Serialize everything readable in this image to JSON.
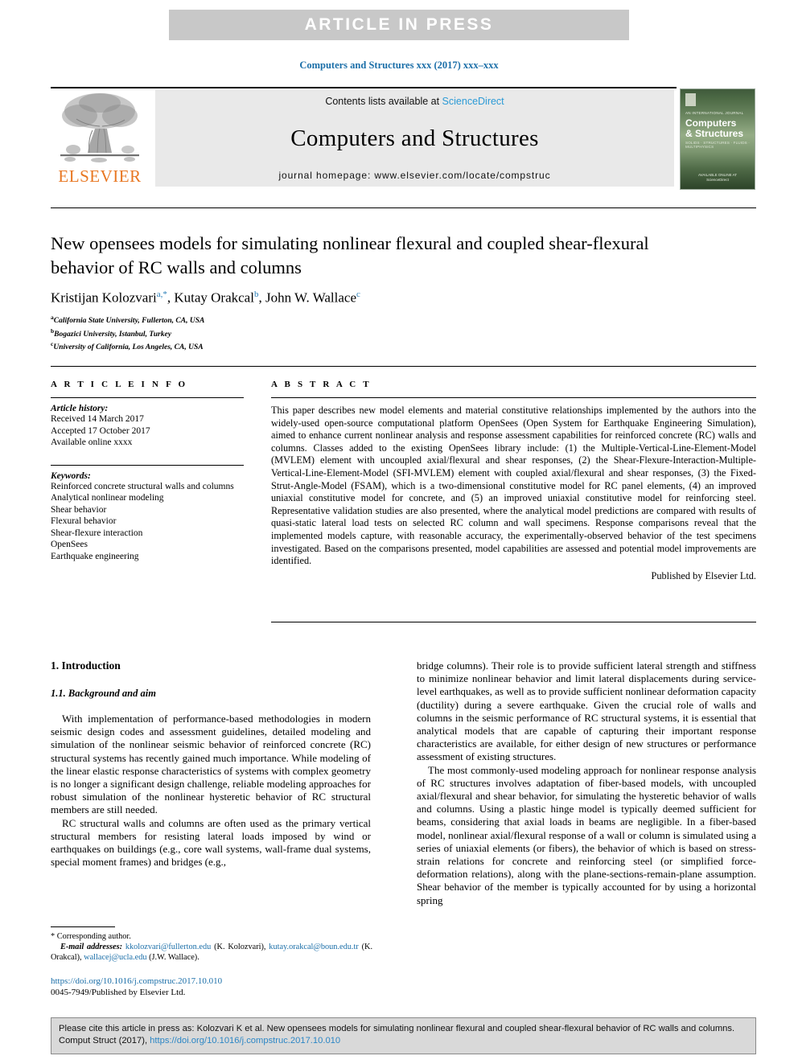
{
  "banner": {
    "text": "ARTICLE  IN  PRESS"
  },
  "running_head": "Computers and Structures xxx (2017) xxx–xxx",
  "journal_header": {
    "contents_prefix": "Contents lists available at ",
    "sciencedirect": "ScienceDirect",
    "journal_name": "Computers and Structures",
    "homepage": "journal homepage: www.elsevier.com/locate/compstruc",
    "publisher_logo_word": "ELSEVIER",
    "cover": {
      "superline": "AN INTERNATIONAL JOURNAL",
      "title_line1": "Computers",
      "title_line2": "& Structures",
      "subtitle": "SOLIDS · STRUCTURES · FLUIDS · MULTIPHYSICS",
      "footer_line1": "AVAILABLE ONLINE AT",
      "footer_line2": "ScienceDirect"
    }
  },
  "article": {
    "title": "New opensees models for simulating nonlinear flexural and coupled shear-flexural behavior of RC walls and columns",
    "authors": [
      {
        "name": "Kristijan Kolozvari",
        "marks": "a,*"
      },
      {
        "name": "Kutay Orakcal",
        "marks": "b"
      },
      {
        "name": "John W. Wallace",
        "marks": "c"
      }
    ],
    "affiliations": [
      {
        "mark": "a",
        "text": "California State University, Fullerton, CA, USA"
      },
      {
        "mark": "b",
        "text": "Bogazici University, Istanbul, Turkey"
      },
      {
        "mark": "c",
        "text": "University of California, Los Angeles, CA, USA"
      }
    ]
  },
  "article_info": {
    "heading": "A R T I C L E   I N F O",
    "history_label": "Article history:",
    "history": [
      "Received 14 March 2017",
      "Accepted 17 October 2017",
      "Available online xxxx"
    ],
    "keywords_label": "Keywords:",
    "keywords": [
      "Reinforced concrete structural walls and columns",
      "Analytical nonlinear modeling",
      "Shear behavior",
      "Flexural behavior",
      "Shear-flexure interaction",
      "OpenSees",
      "Earthquake engineering"
    ]
  },
  "abstract": {
    "heading": "A B S T R A C T",
    "body": "This paper describes new model elements and material constitutive relationships implemented by the authors into the widely-used open-source computational platform OpenSees (Open System for Earthquake Engineering Simulation), aimed to enhance current nonlinear analysis and response assessment capabilities for reinforced concrete (RC) walls and columns. Classes added to the existing OpenSees library include: (1) the Multiple-Vertical-Line-Element-Model (MVLEM) element with uncoupled axial/flexural and shear responses, (2) the Shear-Flexure-Interaction-Multiple-Vertical-Line-Element-Model (SFI-MVLEM) element with coupled axial/flexural and shear responses, (3) the Fixed-Strut-Angle-Model (FSAM), which is a two-dimensional constitutive model for RC panel elements, (4) an improved uniaxial constitutive model for concrete, and (5) an improved uniaxial constitutive model for reinforcing steel. Representative validation studies are also presented, where the analytical model predictions are compared with results of quasi-static lateral load tests on selected RC column and wall specimens. Response comparisons reveal that the implemented models capture, with reasonable accuracy, the experimentally-observed behavior of the test specimens investigated. Based on the comparisons presented, model capabilities are assessed and potential model improvements are identified.",
    "publisher_note": "Published by Elsevier Ltd."
  },
  "body": {
    "section_heading": "1. Introduction",
    "subsection_heading": "1.1. Background and aim",
    "left_paragraphs": [
      "With implementation of performance-based methodologies in modern seismic design codes and assessment guidelines, detailed modeling and simulation of the nonlinear seismic behavior of reinforced concrete (RC) structural systems has recently gained much importance. While modeling of the linear elastic response characteristics of systems with complex geometry is no longer a significant design challenge, reliable modeling approaches for robust simulation of the nonlinear hysteretic behavior of RC structural members are still needed.",
      "RC structural walls and columns are often used as the primary vertical structural members for resisting lateral loads imposed by wind or earthquakes on buildings (e.g., core wall systems, wall-frame dual systems, special moment frames) and bridges (e.g.,"
    ],
    "right_paragraphs": [
      "bridge columns). Their role is to provide sufficient lateral strength and stiffness to minimize nonlinear behavior and limit lateral displacements during service-level earthquakes, as well as to provide sufficient nonlinear deformation capacity (ductility) during a severe earthquake. Given the crucial role of walls and columns in the seismic performance of RC structural systems, it is essential that analytical models that are capable of capturing their important response characteristics are available, for either design of new structures or performance assessment of existing structures.",
      "The most commonly-used modeling approach for nonlinear response analysis of RC structures involves adaptation of fiber-based models, with uncoupled axial/flexural and shear behavior, for simulating the hysteretic behavior of walls and columns. Using a plastic hinge model is typically deemed sufficient for beams, considering that axial loads in beams are negligible. In a fiber-based model, nonlinear axial/flexural response of a wall or column is simulated using a series of uniaxial elements (or fibers), the behavior of which is based on stress-strain relations for concrete and reinforcing steel (or simplified force-deformation relations), along with the plane-sections-remain-plane assumption. Shear behavior of the member is typically accounted for by using a horizontal spring"
    ]
  },
  "footnote": {
    "corresponding": "Corresponding author.",
    "email_label": "E-mail addresses:",
    "emails": [
      {
        "address": "kkolozvari@fullerton.edu",
        "owner": "(K. Kolozvari)"
      },
      {
        "address": "kutay.orakcal@boun.edu.tr",
        "owner": "(K. Orakcal)"
      },
      {
        "address": "wallacej@ucla.edu",
        "owner": "(J.W. Wallace)"
      }
    ],
    "doi_url": "https://doi.org/10.1016/j.compstruc.2017.10.010",
    "issn_line": "0045-7949/Published by Elsevier Ltd."
  },
  "citation_box": {
    "text_before_link": "Please cite this article in press as: Kolozvari K et al. New opensees models for simulating nonlinear flexural and coupled shear-flexural behavior of RC walls and columns. Comput Struct (2017), ",
    "link": "https://doi.org/10.1016/j.compstruc.2017.10.010"
  },
  "colors": {
    "banner_bg": "#c8c8c8",
    "link_blue": "#1a6ea8",
    "sciencedirect_blue": "#2b9ad6",
    "elsevier_orange": "#E87722",
    "header_band": "#e9e9e9",
    "cite_box_bg": "#d9d9d9"
  }
}
